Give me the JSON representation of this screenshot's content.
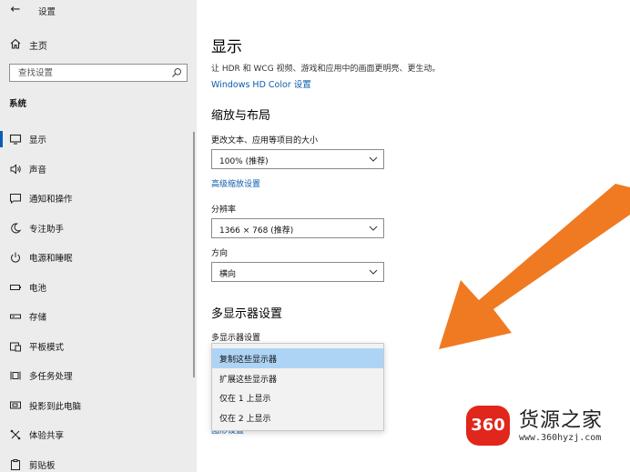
{
  "titlebar": {
    "back_glyph": "←",
    "title": "设置"
  },
  "sidebar": {
    "home_label": "主页",
    "search_placeholder": "查找设置",
    "section_header": "系统",
    "items": [
      {
        "label": "显示",
        "icon": "monitor-icon",
        "active": true
      },
      {
        "label": "声音",
        "icon": "speaker-icon"
      },
      {
        "label": "通知和操作",
        "icon": "notification-icon"
      },
      {
        "label": "专注助手",
        "icon": "moon-icon"
      },
      {
        "label": "电源和睡眠",
        "icon": "power-icon"
      },
      {
        "label": "电池",
        "icon": "battery-icon"
      },
      {
        "label": "存储",
        "icon": "storage-icon"
      },
      {
        "label": "平板模式",
        "icon": "tablet-icon"
      },
      {
        "label": "多任务处理",
        "icon": "multitask-icon"
      },
      {
        "label": "投影到此电脑",
        "icon": "projection-icon"
      },
      {
        "label": "体验共享",
        "icon": "share-icon"
      },
      {
        "label": "剪贴板",
        "icon": "clipboard-icon"
      }
    ]
  },
  "main": {
    "title": "显示",
    "description": "让 HDR 和 WCG 视频、游戏和应用中的画面更明亮、更生动。",
    "hdr_link": "Windows HD Color 设置",
    "scale_heading": "缩放与布局",
    "scale_label": "更改文本、应用等项目的大小",
    "scale_value": "100% (推荐)",
    "advanced_scale_link": "高级缩放设置",
    "resolution_label": "分辨率",
    "resolution_value": "1366 × 768 (推荐)",
    "orientation_label": "方向",
    "orientation_value": "横向",
    "multi_heading": "多显示器设置",
    "multi_label": "多显示器设置",
    "multi_options": [
      "复制这些显示器",
      "扩展这些显示器",
      "仅在 1 上显示",
      "仅在 2 上显示"
    ],
    "multi_selected_index": 0,
    "behind_link_fragment": "图形设置"
  },
  "watermark": {
    "badge": "360",
    "title": "货源之家",
    "url": "www.360hyzj.com"
  },
  "colors": {
    "accent": "#0b5cad",
    "sidebar_bg": "#ececec",
    "selected_bg": "#aed4f5",
    "arrow": "#f07a22",
    "badge": "#e1261c"
  }
}
